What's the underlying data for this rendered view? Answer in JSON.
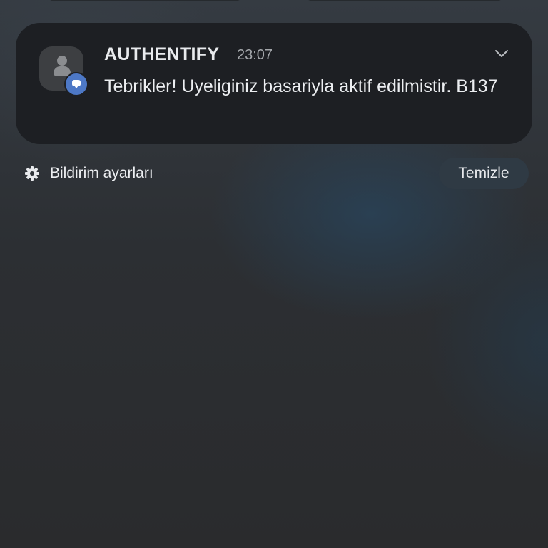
{
  "notification": {
    "app_name": "AUTHENTIFY",
    "time": "23:07",
    "message": "Tebrikler! Uyeliginiz basariyla aktif edilmistir. B137",
    "app_icon": "person-icon",
    "badge_icon": "message-bubble-icon",
    "badge_color": "#4d78c6",
    "expand_icon": "chevron-down-icon"
  },
  "footer": {
    "settings_icon": "gear-icon",
    "settings_label": "Bildirim ayarları",
    "clear_label": "Temizle"
  }
}
